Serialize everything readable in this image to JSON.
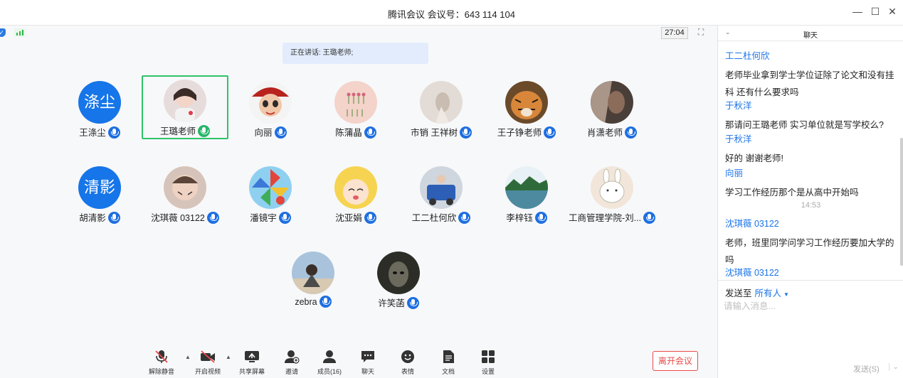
{
  "window": {
    "title": "腾讯会议 会议号：643 114 104",
    "minimize_icon": "minimize-icon",
    "maximize_icon": "maximize-icon",
    "close_icon": "close-icon"
  },
  "status": {
    "timer": "27:04",
    "speaking": "正在讲话: 王璐老师;"
  },
  "participants": [
    {
      "name": "王涤尘",
      "avatar_text": "涤尘",
      "avatar_color": "#1675e8"
    },
    {
      "name": "王璐老师",
      "avatar_color": "#e9d7d8",
      "active": true
    },
    {
      "name": "向丽",
      "avatar_color": "#c4463a"
    },
    {
      "name": "陈蒲晶",
      "avatar_color": "#f1cfc6"
    },
    {
      "name": "市销 王祥树",
      "avatar_color": "#d8d2cc"
    },
    {
      "name": "王子铮老师",
      "avatar_color": "#9b6b3c"
    },
    {
      "name": "肖潇老师",
      "avatar_color": "#5a4d43"
    },
    {
      "name": "胡清影",
      "avatar_text": "清影",
      "avatar_color": "#1675e8"
    },
    {
      "name": "沈琪薇 03122",
      "avatar_color": "#cfb4a8"
    },
    {
      "name": "潘镜宇",
      "avatar_color": "#5bb5e8"
    },
    {
      "name": "沈亚娟",
      "avatar_color": "#f2d35a"
    },
    {
      "name": "工二杜何欣",
      "avatar_color": "#5a8fc4"
    },
    {
      "name": "李梓钰",
      "avatar_color": "#3f7a86"
    },
    {
      "name": "工商管理学院-刘...",
      "avatar_color": "#f1e1d3"
    },
    {
      "name": "zebra",
      "avatar_color": "#6f8fb0"
    },
    {
      "name": "许笑菡",
      "avatar_color": "#2f2f2a"
    }
  ],
  "toolbar": {
    "mute": "解除静音",
    "video": "开启视频",
    "share": "共享屏幕",
    "invite": "邀请",
    "members": "成员(16)",
    "chat": "聊天",
    "emoji": "表情",
    "docs": "文档",
    "settings": "设置",
    "leave": "离开会议"
  },
  "chat": {
    "title": "聊天",
    "messages": [
      {
        "from": "工二杜何欣",
        "text": "老师毕业拿到学士学位证除了论文和没有挂科 还有什么要求吗"
      },
      {
        "from": "于秋洋",
        "text": "那请问王璐老师 实习单位就是写学校么?"
      },
      {
        "from": "于秋洋",
        "text": "好的 谢谢老师!"
      },
      {
        "from": "向丽",
        "text": "学习工作经历那个是从高中开始吗"
      },
      {
        "from": "沈琪薇 03122",
        "text": "老师，班里同学问学习工作经历要加大学的吗"
      },
      {
        "from": "沈琪薇 03122",
        "text": ""
      }
    ],
    "timestamp": "14:53",
    "send_to_label": "发送至",
    "send_to_value": "所有人",
    "input_placeholder": "请输入消息...",
    "send_button": "发送(S)"
  },
  "colors": {
    "accent": "#1a73e8",
    "active_border": "#2ec36a",
    "leave_red": "#e84a4a"
  }
}
